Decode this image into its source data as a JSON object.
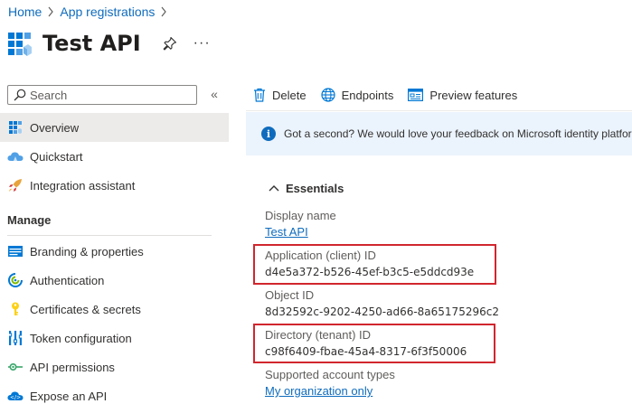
{
  "breadcrumb": {
    "home": "Home",
    "app_registrations": "App registrations"
  },
  "header": {
    "title": "Test API",
    "more": "···"
  },
  "search": {
    "placeholder": "Search"
  },
  "nav": {
    "top": [
      {
        "label": "Overview",
        "icon": "grid-icon",
        "active": true
      },
      {
        "label": "Quickstart",
        "icon": "cloud-icon"
      },
      {
        "label": "Integration assistant",
        "icon": "rocket-icon"
      }
    ],
    "section": "Manage",
    "manage": [
      {
        "label": "Branding & properties",
        "icon": "branding-icon"
      },
      {
        "label": "Authentication",
        "icon": "authentication-icon"
      },
      {
        "label": "Certificates & secrets",
        "icon": "key-icon"
      },
      {
        "label": "Token configuration",
        "icon": "token-icon"
      },
      {
        "label": "API permissions",
        "icon": "permissions-icon"
      },
      {
        "label": "Expose an API",
        "icon": "cloud-expose-icon"
      }
    ]
  },
  "toolbar": {
    "delete": "Delete",
    "endpoints": "Endpoints",
    "preview": "Preview features"
  },
  "banner": {
    "text": "Got a second? We would love your feedback on Microsoft identity platform"
  },
  "essentials": {
    "heading": "Essentials",
    "display_name_label": "Display name",
    "display_name_value": "Test API",
    "client_id_label": "Application (client) ID",
    "client_id_value": "d4e5a372-b526-45ef-b3c5-e5ddcd93e",
    "object_id_label": "Object ID",
    "object_id_value": "8d32592c-9202-4250-ad66-8a65175296c2",
    "tenant_id_label": "Directory (tenant) ID",
    "tenant_id_value": "c98f6409-fbae-45a4-8317-6f3f50006",
    "account_types_label": "Supported account types",
    "account_types_value": "My organization only"
  },
  "colors": {
    "accent": "#0f6cbd",
    "highlight": "#d1262e",
    "banner": "#ebf3fc",
    "active_nav": "#edebe9"
  }
}
